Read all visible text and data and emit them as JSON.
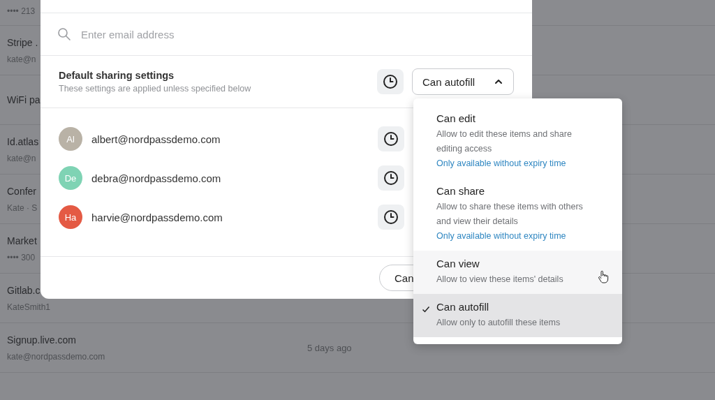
{
  "background_list": [
    {
      "subtitle": "•••• 213"
    },
    {
      "title": "Stripe .",
      "subtitle": "kate@n"
    },
    {
      "title": "WiFi pa"
    },
    {
      "title": "Id.atlas",
      "subtitle": "kate@n"
    },
    {
      "title": "Confer",
      "subtitle": "Kate · S"
    },
    {
      "title": "Market",
      "subtitle": "•••• 300"
    },
    {
      "title": "Gitlab.c",
      "subtitle": "KateSmith1"
    },
    {
      "title": "Signup.live.com",
      "subtitle": "kate@nordpassdemo.com",
      "date": "5 days ago"
    }
  ],
  "dialog": {
    "search": {
      "placeholder": "Enter email address"
    },
    "default_settings": {
      "title": "Default sharing settings",
      "description": "These settings are applied unless specified below",
      "permission": "Can autofill",
      "expanded": true
    },
    "users": [
      {
        "initials": "Al",
        "email": "albert@nordpassdemo.com",
        "color": "#b9b2a6"
      },
      {
        "initials": "De",
        "email": "debra@nordpassdemo.com",
        "color": "#7fd3b4"
      },
      {
        "initials": "Ha",
        "email": "harvie@nordpassdemo.com",
        "color": "#e45a44"
      }
    ],
    "footer_button": "Can"
  },
  "permission_menu": [
    {
      "label": "Can edit",
      "description": "Allow to edit these items and share editing access",
      "note": "Only available without expiry time",
      "selected": false,
      "hovered": false
    },
    {
      "label": "Can share",
      "description": "Allow to share these items with others and view their details",
      "note": "Only available without expiry time",
      "selected": false,
      "hovered": false
    },
    {
      "label": "Can view",
      "description": "Allow to view these items' details",
      "selected": false,
      "hovered": true
    },
    {
      "label": "Can autofill",
      "description": "Allow only to autofill these items",
      "selected": true,
      "hovered": false
    }
  ]
}
